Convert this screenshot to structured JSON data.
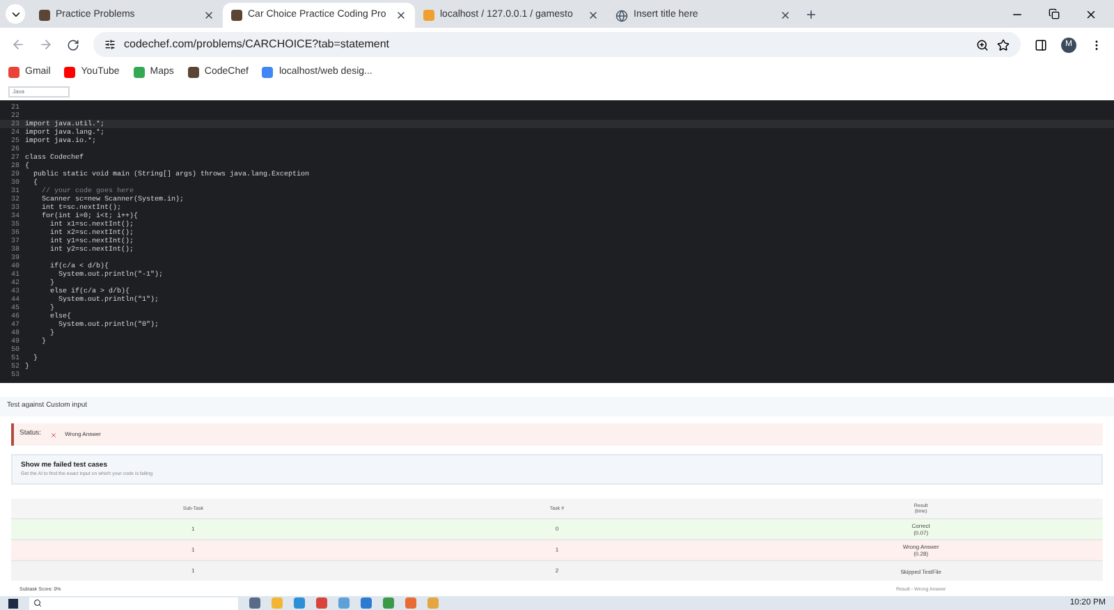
{
  "browser": {
    "tabs": [
      {
        "title": "Practice Problems",
        "selected": false,
        "kind": "cc"
      },
      {
        "title": "Car Choice Practice Coding Pro",
        "selected": true,
        "kind": "cc"
      },
      {
        "title": "localhost / 127.0.0.1 / gamesto",
        "selected": false,
        "kind": "pma"
      },
      {
        "title": "Insert title here",
        "selected": false,
        "kind": "globe"
      }
    ],
    "url": "codechef.com/problems/CARCHOICE?tab=statement",
    "bookmarks": [
      {
        "label": "Gmail",
        "kind": "gmail"
      },
      {
        "label": "YouTube",
        "kind": "youtube"
      },
      {
        "label": "Maps",
        "kind": "maps"
      },
      {
        "label": "CodeChef",
        "kind": "cc"
      },
      {
        "label": "localhost/web desig...",
        "kind": "google"
      }
    ],
    "profile": "M"
  },
  "language_select": "Java",
  "editor": {
    "lines": [
      {
        "number": "21",
        "active": false
      },
      {
        "number": "22",
        "active": false
      },
      {
        "number": "23",
        "code": "import java.util.*;",
        "kind": "code",
        "active": true
      },
      {
        "number": "24",
        "code": "import java.lang.*;",
        "kind": "code",
        "active": false
      },
      {
        "number": "25",
        "code": "import java.io.*;",
        "kind": "code",
        "active": false
      },
      {
        "number": "26",
        "active": false
      },
      {
        "number": "27",
        "code": "class Codechef",
        "kind": "code",
        "active": false
      },
      {
        "number": "28",
        "code": "{",
        "kind": "code",
        "active": false
      },
      {
        "number": "29",
        "code": "  public static void main (String[] args) throws java.lang.Exception",
        "kind": "code",
        "active": false
      },
      {
        "number": "30",
        "code": "  {",
        "kind": "code",
        "active": false
      },
      {
        "number": "31",
        "code": "    // your code goes here",
        "kind": "comment",
        "active": false
      },
      {
        "number": "32",
        "code": "    Scanner sc=new Scanner(System.in);",
        "kind": "code",
        "active": false
      },
      {
        "number": "33",
        "code": "    int t=sc.nextInt();",
        "kind": "code",
        "active": false
      },
      {
        "number": "34",
        "code": "    for(int i=0; i<t; i++){",
        "kind": "code",
        "active": false
      },
      {
        "number": "35",
        "code": "      int x1=sc.nextInt();",
        "kind": "code",
        "active": false
      },
      {
        "number": "36",
        "code": "      int x2=sc.nextInt();",
        "kind": "code",
        "active": false
      },
      {
        "number": "37",
        "code": "      int y1=sc.nextInt();",
        "kind": "code",
        "active": false
      },
      {
        "number": "38",
        "code": "      int y2=sc.nextInt();",
        "kind": "code",
        "active": false
      },
      {
        "number": "39",
        "active": false
      },
      {
        "number": "40",
        "code": "      if(c/a < d/b){",
        "kind": "code",
        "active": false
      },
      {
        "number": "41",
        "code": "        System.out.println(\"-1\");",
        "kind": "code",
        "active": false
      },
      {
        "number": "42",
        "code": "      }",
        "kind": "code",
        "active": false
      },
      {
        "number": "43",
        "code": "      else if(c/a > d/b){",
        "kind": "code",
        "active": false
      },
      {
        "number": "44",
        "code": "        System.out.println(\"1\");",
        "kind": "code",
        "active": false
      },
      {
        "number": "45",
        "code": "      }",
        "kind": "code",
        "active": false
      },
      {
        "number": "46",
        "code": "      else{",
        "kind": "code",
        "active": false
      },
      {
        "number": "47",
        "code": "        System.out.println(\"0\");",
        "kind": "code",
        "active": false
      },
      {
        "number": "48",
        "code": "      }",
        "kind": "code",
        "active": false
      },
      {
        "number": "49",
        "code": "    }",
        "kind": "code",
        "active": false
      },
      {
        "number": "50",
        "active": false
      },
      {
        "number": "51",
        "code": "  }",
        "kind": "code",
        "active": false
      },
      {
        "number": "52",
        "code": "}",
        "kind": "code",
        "active": false
      },
      {
        "number": "53",
        "active": false
      }
    ]
  },
  "custom_input": "Test against Custom input",
  "status": {
    "label": "Status:",
    "value": "Wrong Answer"
  },
  "failed_cases": {
    "title": "Show me failed test cases",
    "subtitle": "Get the AI to find the exact input on which your code is failing"
  },
  "results": {
    "columns": [
      "Sub-Task",
      "Task #",
      "Result\n(time)"
    ],
    "rows": [
      {
        "subtask": "1",
        "task": "0",
        "result": "Correct",
        "time": "(0.07)",
        "kind": "correct"
      },
      {
        "subtask": "1",
        "task": "1",
        "result": "Wrong Answer",
        "time": "(0.28)",
        "kind": "wrong"
      },
      {
        "subtask": "1",
        "task": "2",
        "result": "Skipped TestFile",
        "kind": "skipped"
      }
    ],
    "score": "Subtask Score: 0%",
    "final": "Result - Wrong Answer"
  },
  "taskbar": {
    "time": "10:20 PM"
  }
}
